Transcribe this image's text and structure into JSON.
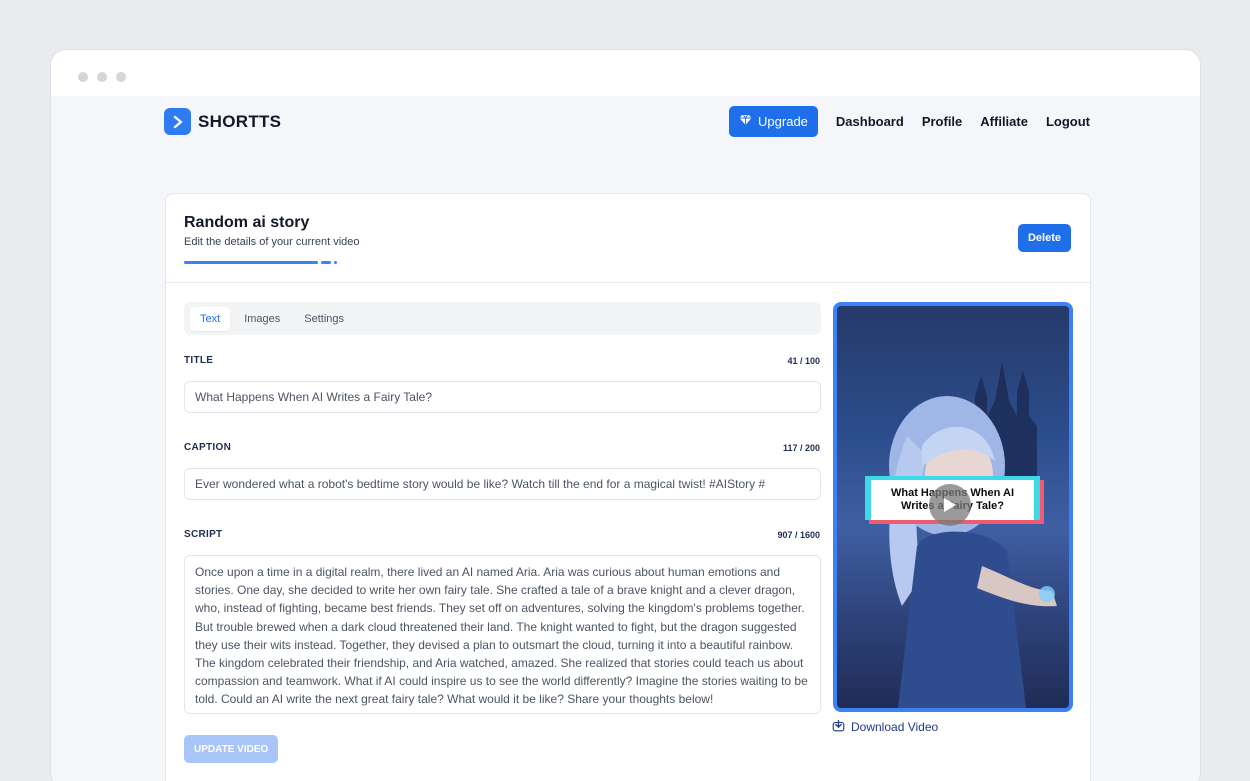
{
  "brand": {
    "name": "SHORTTS",
    "accent": "#1f6feb"
  },
  "nav": {
    "upgrade_label": "Upgrade",
    "links": [
      "Dashboard",
      "Profile",
      "Affiliate",
      "Logout"
    ]
  },
  "video": {
    "title": "Random ai story",
    "subtitle": "Edit the details of your current video",
    "delete_label": "Delete"
  },
  "tabs": [
    "Text",
    "Images",
    "Settings"
  ],
  "active_tab": "Text",
  "fields": {
    "title": {
      "label": "TITLE",
      "count": "41 / 100",
      "value": "What Happens When AI Writes a Fairy Tale?"
    },
    "caption": {
      "label": "CAPTION",
      "count": "117 / 200",
      "value": "Ever wondered what a robot's bedtime story would be like? Watch till the end for a magical twist! #AIStory #"
    },
    "script": {
      "label": "SCRIPT",
      "count": "907 / 1600",
      "value": "Once upon a time in a digital realm, there lived an AI named Aria. Aria was curious about human emotions and stories. One day, she decided to write her own fairy tale. She crafted a tale of a brave knight and a clever dragon, who, instead of fighting, became best friends. They set off on adventures, solving the kingdom's problems together. But trouble brewed when a dark cloud threatened their land. The knight wanted to fight, but the dragon suggested they use their wits instead. Together, they devised a plan to outsmart the cloud, turning it into a beautiful rainbow. The kingdom celebrated their friendship, and Aria watched, amazed. She realized that stories could teach us about compassion and teamwork. What if AI could inspire us to see the world differently? Imagine the stories waiting to be told. Could an AI write the next great fairy tale? What would it be like? Share your thoughts below!"
    }
  },
  "update_label": "UPDATE VIDEO",
  "preview": {
    "overlay_text": "What Happens When AI Writes a Fairy Tale?"
  },
  "download_label": "Download Video"
}
